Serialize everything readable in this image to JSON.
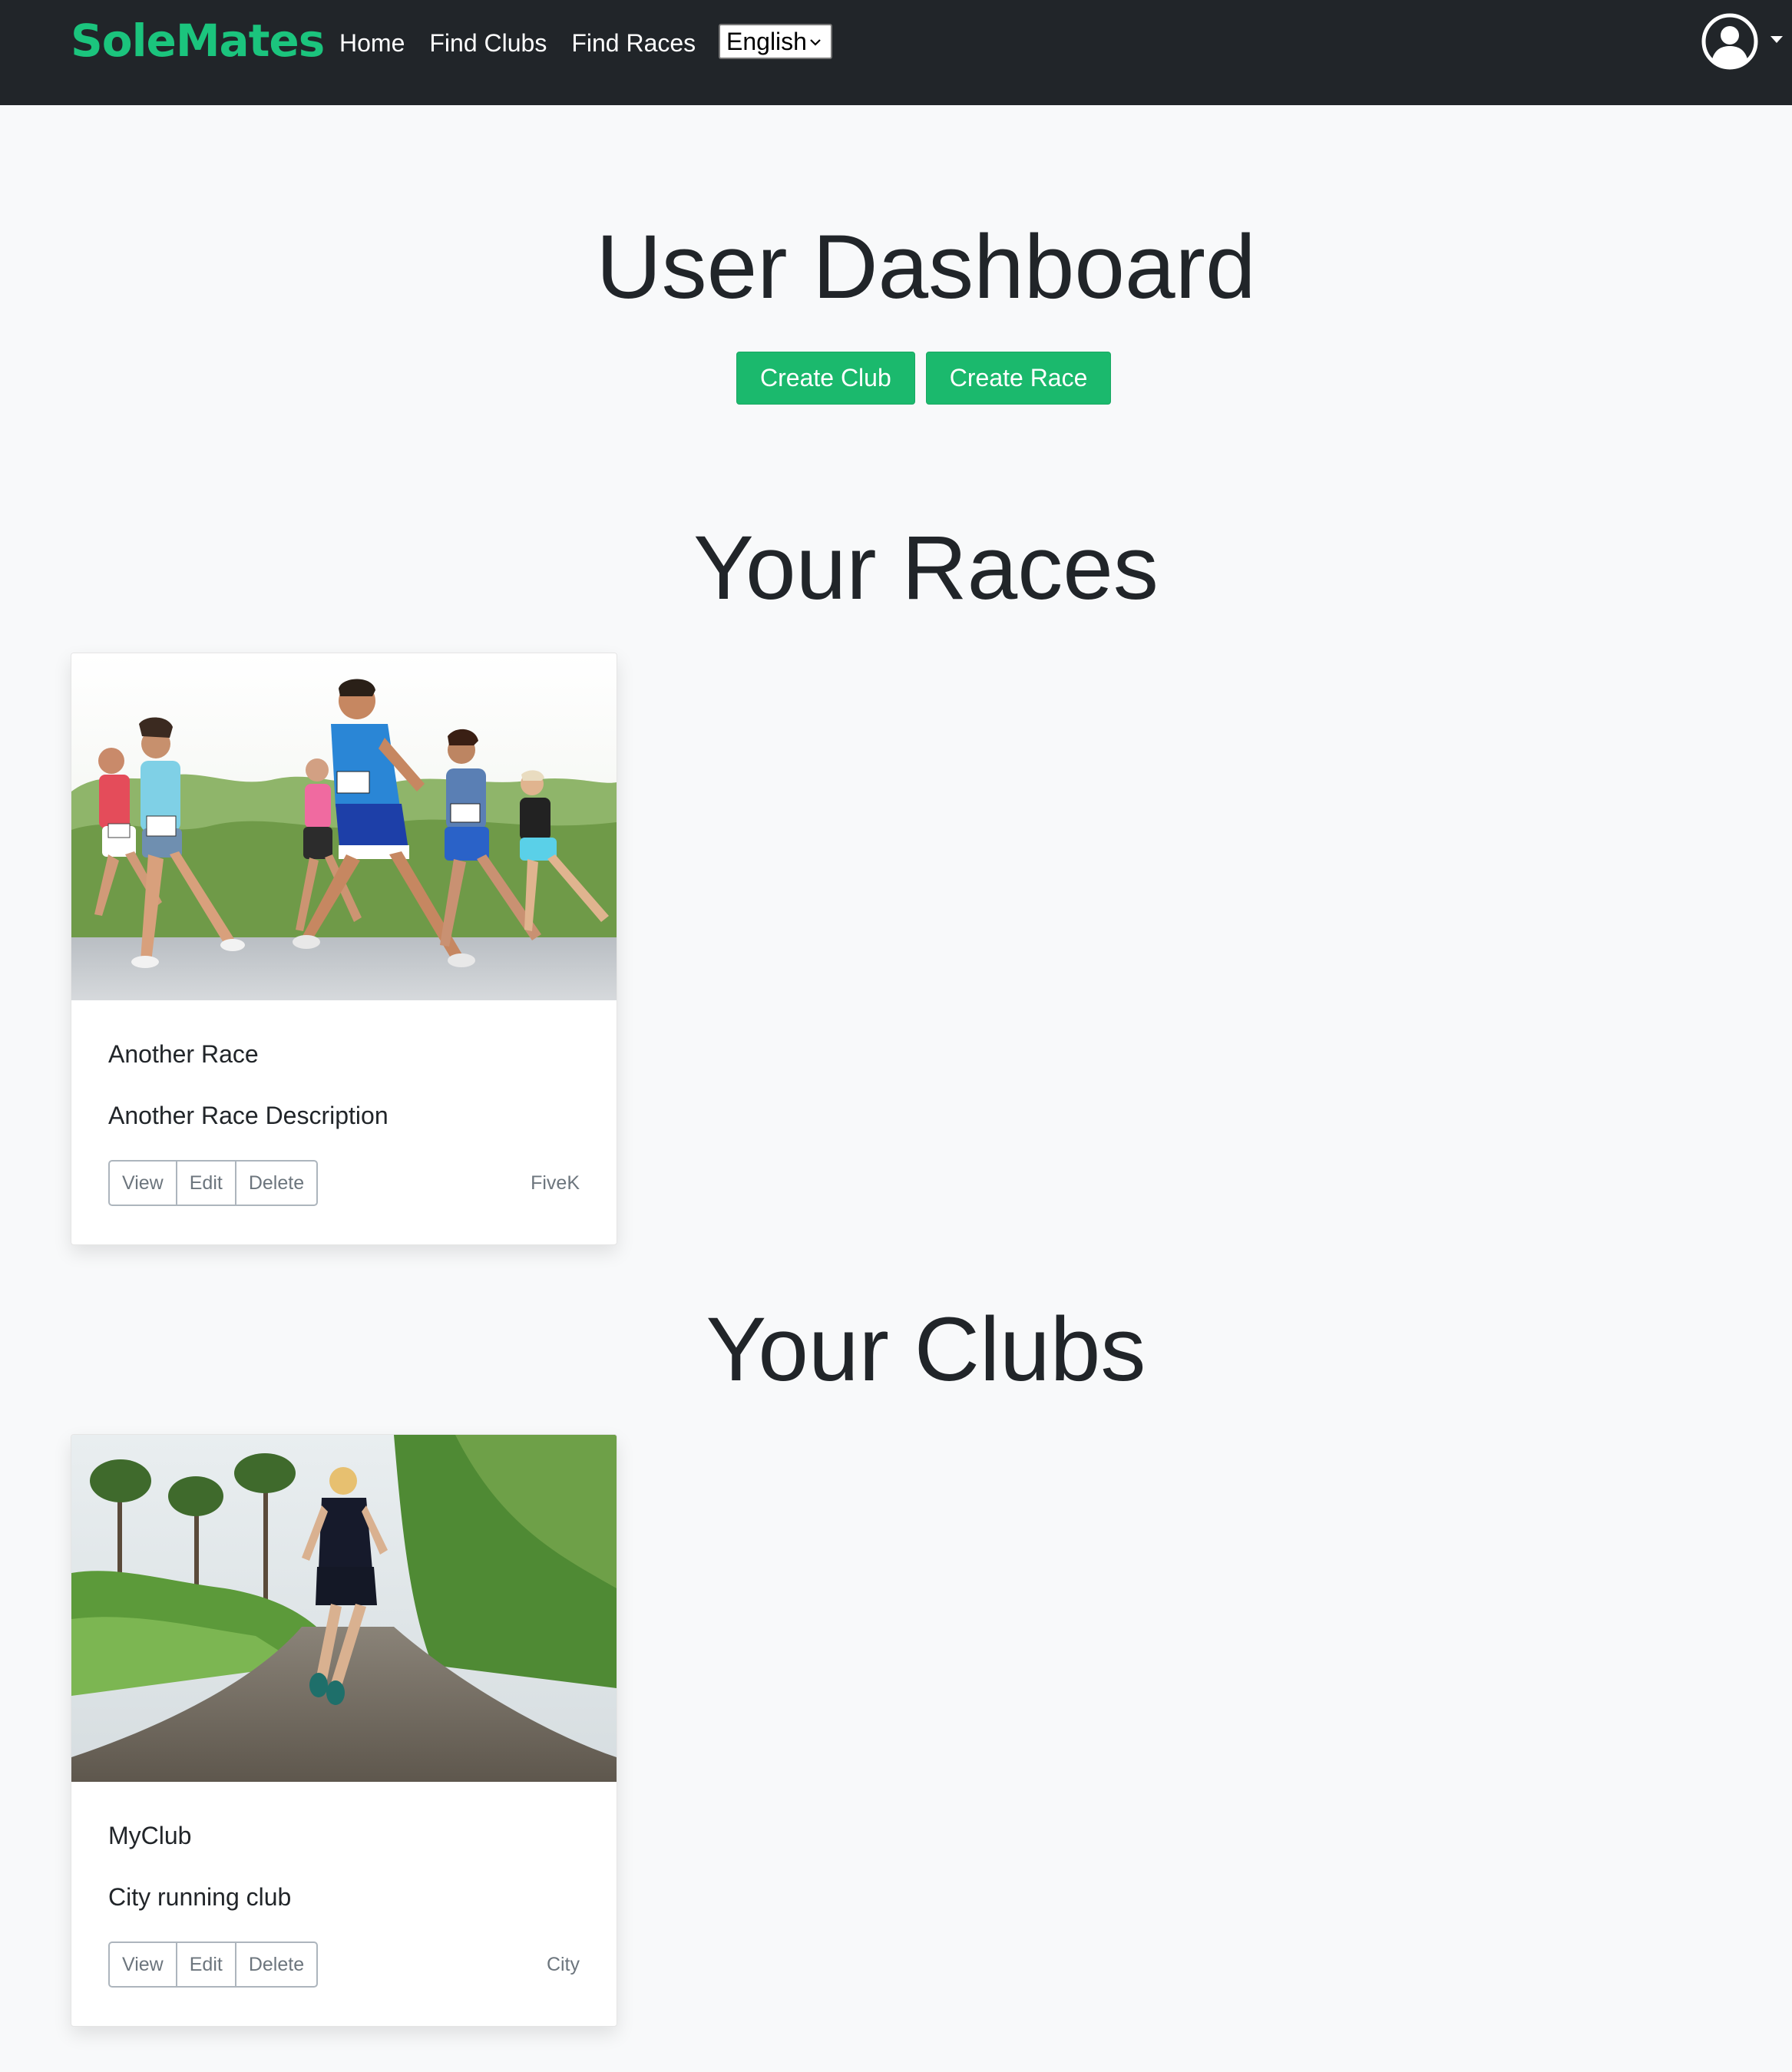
{
  "navbar": {
    "brand": "SoleMates",
    "links": [
      "Home",
      "Find Clubs",
      "Find Races"
    ],
    "language": "English",
    "user_icon": "user-circle-icon"
  },
  "page": {
    "title": "User Dashboard",
    "actions": {
      "create_club": "Create Club",
      "create_race": "Create Race"
    },
    "races_heading": "Your Races",
    "clubs_heading": "Your Clubs"
  },
  "races": [
    {
      "title": "Another Race",
      "description": "Another Race Description",
      "category": "FiveK",
      "buttons": {
        "view": "View",
        "edit": "Edit",
        "delete": "Delete"
      },
      "image": "race-runners-photo"
    }
  ],
  "clubs": [
    {
      "title": "MyClub",
      "description": "City running club",
      "category": "City",
      "buttons": {
        "view": "View",
        "edit": "Edit",
        "delete": "Delete"
      },
      "image": "trail-runner-photo"
    }
  ],
  "colors": {
    "brand": "#1bc47d",
    "button_green": "#1bb96d",
    "navbar": "#212529",
    "background": "#f8f9fa"
  }
}
